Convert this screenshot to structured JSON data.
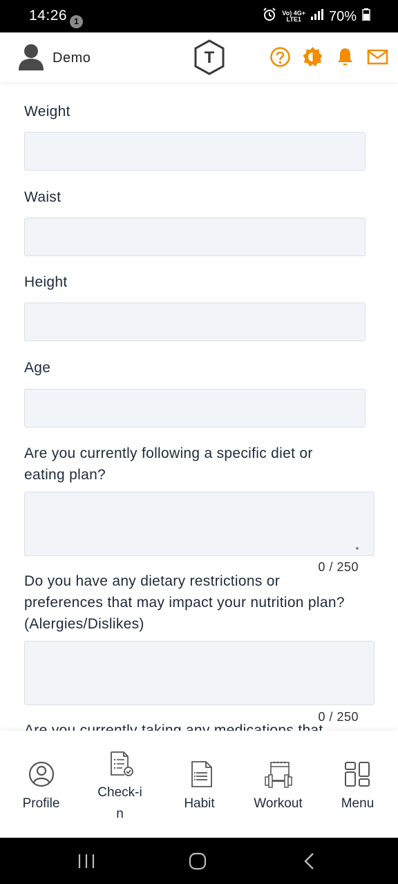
{
  "status_bar": {
    "time": "14:26",
    "notification_count": "1",
    "network_top": "Vo) 4G+",
    "network_bottom": "LTE1",
    "battery": "70%"
  },
  "header": {
    "user_name": "Demo",
    "logo_letter": "T",
    "accent_color": "#f28c00"
  },
  "form": {
    "fields": [
      {
        "label": "Weight",
        "value": ""
      },
      {
        "label": "Waist",
        "value": ""
      },
      {
        "label": "Height",
        "value": ""
      },
      {
        "label": "Age",
        "value": ""
      }
    ],
    "questions": [
      {
        "label": "Are you currently following a specific diet or eating plan?",
        "counter": "0 / 250"
      },
      {
        "label": "Do you have any dietary restrictions or preferences that may impact your nutrition plan?(Alergies/Dislikes)",
        "counter": "0 / 250"
      },
      {
        "label": "Are you currently taking any medications that"
      }
    ]
  },
  "bottom_nav": [
    {
      "label": "Profile",
      "icon": "profile-icon"
    },
    {
      "label": "Check-in",
      "icon": "checkin-icon"
    },
    {
      "label": "Habit",
      "icon": "habit-icon"
    },
    {
      "label": "Workout",
      "icon": "workout-icon"
    },
    {
      "label": "Menu",
      "icon": "menu-grid-icon"
    }
  ]
}
